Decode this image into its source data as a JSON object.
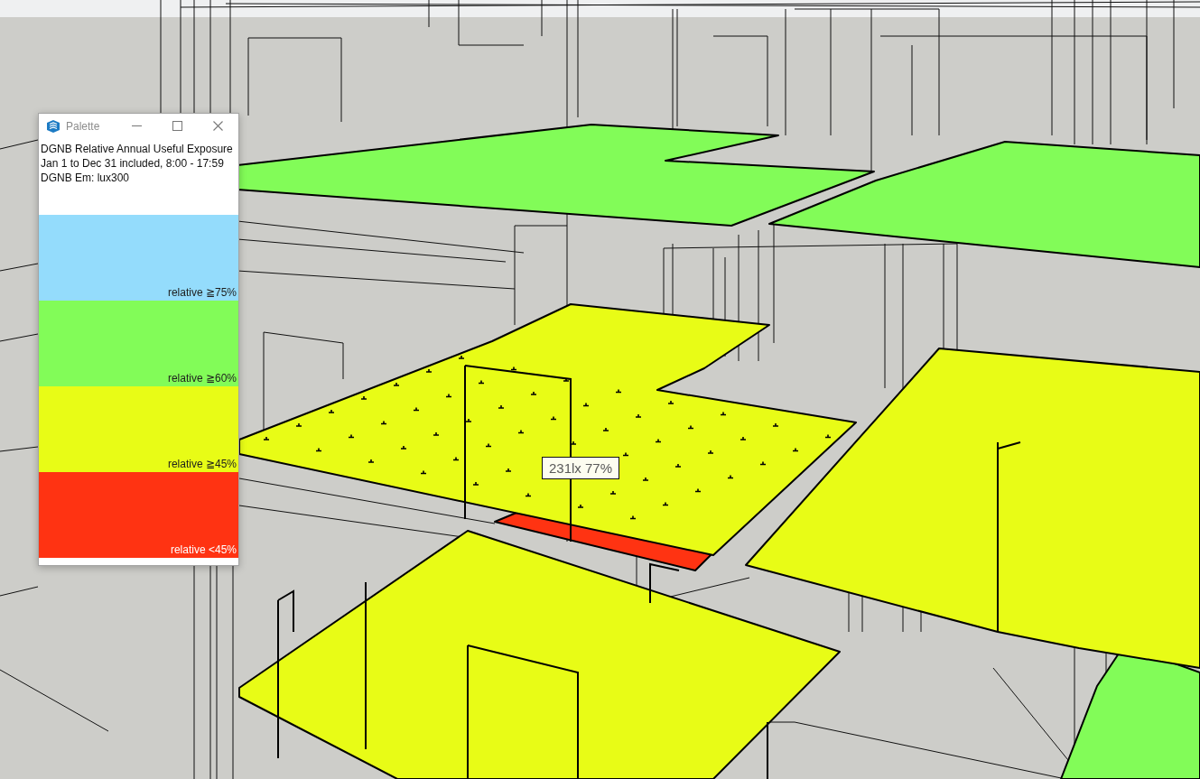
{
  "palette_window": {
    "title": "Palette",
    "lines": [
      "DGNB Relative Annual Useful Exposure",
      "Jan 1 to Dec 31 included, 8:00 - 17:59",
      "DGNB Em: lux300"
    ],
    "legend": [
      {
        "label": "relative ≧75%",
        "color": "#94dcfc"
      },
      {
        "label": "relative ≧60%",
        "color": "#82fc58"
      },
      {
        "label": "relative ≧45%",
        "color": "#e8fc16"
      },
      {
        "label": "relative <45%",
        "color": "#ff3312"
      }
    ]
  },
  "viewport": {
    "tooltip": "231lx 77%"
  }
}
